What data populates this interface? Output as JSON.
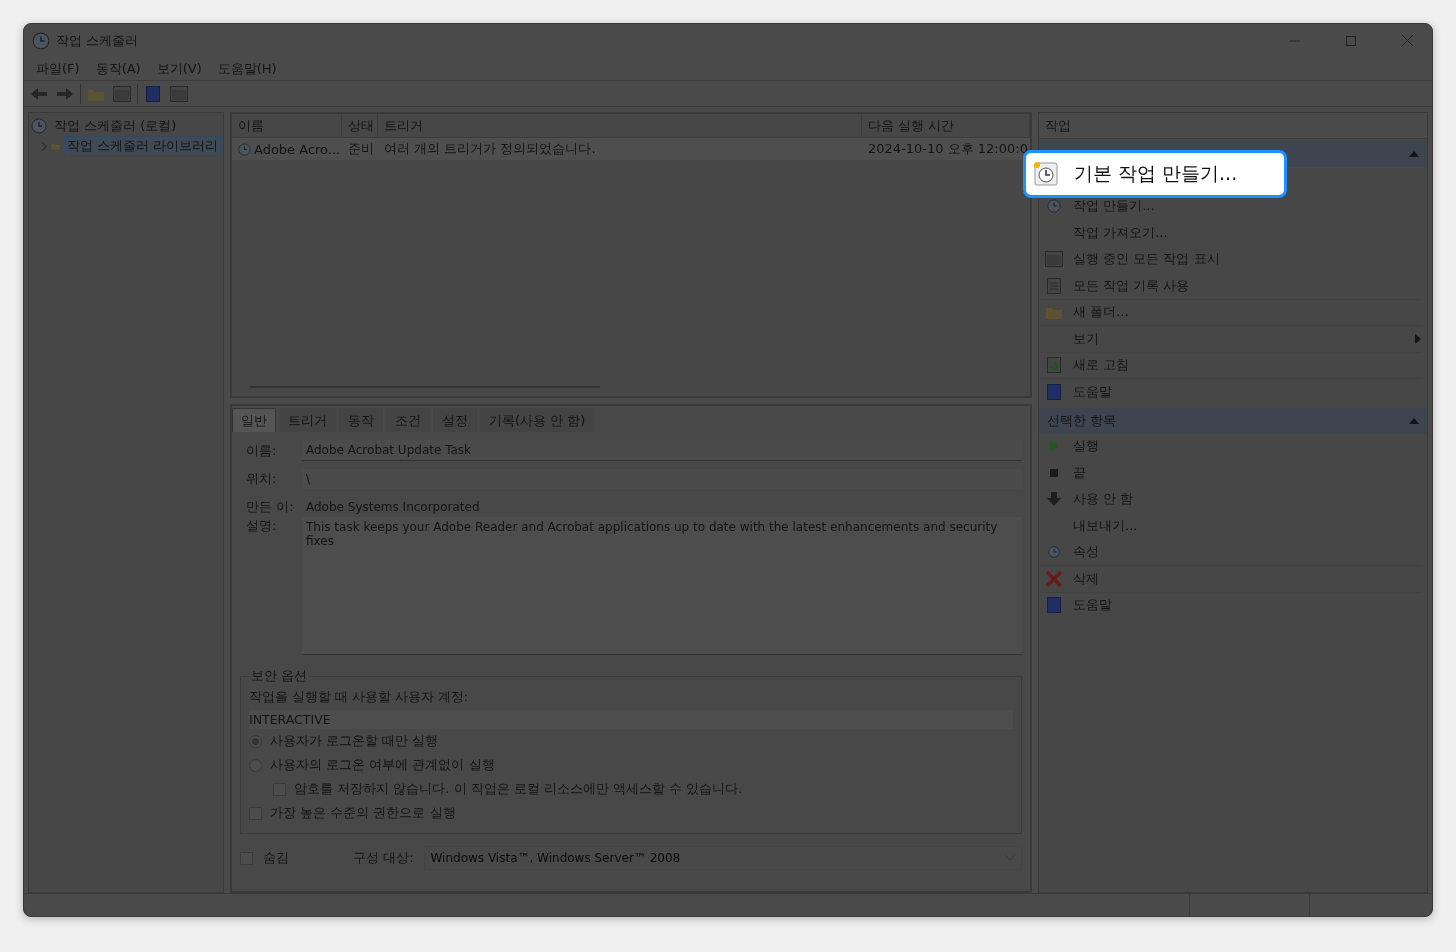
{
  "window": {
    "title": "작업 스케줄러"
  },
  "menu": [
    {
      "label": "파일(F)"
    },
    {
      "label": "동작(A)"
    },
    {
      "label": "보기(V)"
    },
    {
      "label": "도움말(H)"
    }
  ],
  "tree": [
    {
      "label": "작업 스케줄러 (로컬)",
      "selected": false,
      "children": [
        {
          "label": "작업 스케줄러 라이브러리",
          "selected": true,
          "expanded": false
        }
      ]
    }
  ],
  "task_list": {
    "columns": [
      "이름",
      "상태",
      "트리거",
      "다음 실행 시간"
    ],
    "rows": [
      {
        "cells": [
          "Adobe Acro...",
          "준비",
          "여러 개의 트리거가 정의되었습니다.",
          "2024-10-10 오후 12:00:0"
        ],
        "selected": true
      }
    ]
  },
  "tabs": [
    {
      "label": "일반",
      "selected": true
    },
    {
      "label": "트리거",
      "selected": false
    },
    {
      "label": "동작",
      "selected": false
    },
    {
      "label": "조건",
      "selected": false
    },
    {
      "label": "설정",
      "selected": false
    },
    {
      "label": "기록(사용 안 함)",
      "selected": false
    }
  ],
  "general": {
    "fields": [
      {
        "label": "이름:",
        "value": "Adobe Acrobat Update Task",
        "kind": "input"
      },
      {
        "label": "위치:",
        "value": "\\",
        "kind": "readonly"
      },
      {
        "label": "만든 이:",
        "value": "Adobe Systems Incorporated",
        "kind": "plain"
      },
      {
        "label": "설명:",
        "value": "This task keeps your Adobe Reader and Acrobat applications up to date with the latest enhancements and security fixes",
        "kind": "multiline"
      }
    ]
  },
  "security": {
    "title": "보안 옵션",
    "account_label": "작업을 실행할 때 사용할 사용자 계정:",
    "account": "INTERACTIVE",
    "options": [
      {
        "kind": "radio",
        "label": "사용자가 로그온할 때만 실행",
        "selected": true
      },
      {
        "kind": "radio",
        "label": "사용자의 로그온 여부에 관계없이 실행",
        "selected": false,
        "children": [
          {
            "kind": "checkbox",
            "label": "암호를 저장하지 않습니다. 이 작업은 로컬 리소스에만 액세스할 수 있습니다.",
            "checked": false
          }
        ]
      },
      {
        "kind": "checkbox",
        "label": "가장 높은 수준의 권한으로 실행",
        "checked": false
      }
    ]
  },
  "hidden": {
    "label": "숨김",
    "checked": false
  },
  "configure": {
    "label": "구성 대상:",
    "value": "Windows Vista™, Windows Server™ 2008",
    "disabled": true
  },
  "actions": {
    "title": "작업",
    "sections": [
      {
        "expanded": true,
        "items": [
          {
            "label": "기본 작업 만들기...",
            "highlighted": true
          },
          {
            "label": "작업 만들기..."
          },
          {
            "label": "작업 가져오기..."
          },
          {
            "label": "실행 중인 모든 작업 표시"
          },
          {
            "label": "모든 작업 기록 사용",
            "divider": true
          },
          {
            "label": "새 폴더...",
            "divider": true
          },
          {
            "label": "보기",
            "submenu": true,
            "divider": true
          },
          {
            "label": "새로 고침",
            "divider": true
          },
          {
            "label": "도움말"
          }
        ]
      },
      {
        "title": "선택한 항목",
        "expanded": true,
        "items": [
          {
            "label": "실행"
          },
          {
            "label": "끝"
          },
          {
            "label": "사용 안 함"
          },
          {
            "label": "내보내기..."
          },
          {
            "label": "속성",
            "divider": true
          },
          {
            "label": "삭제",
            "divider": true
          },
          {
            "label": "도움말"
          }
        ]
      }
    ]
  }
}
